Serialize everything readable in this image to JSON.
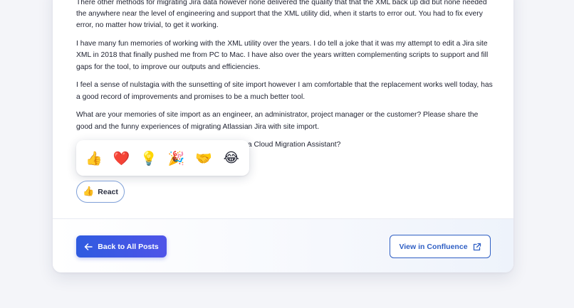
{
  "post": {
    "paragraphs": [
      "There other methods for migrating Jira data however none delivered the quality that that the XML back up did but none needed the anywhere near the level of engineering and support that the XML utility did, when it starts to error out. You had to fix every error, no matter how trivial, to get it working.",
      "I have many fun memories of working with the XML utility over the years. I do tell a joke that it was my attempt to edit a Jira site XML in 2018 that finally pushed me from PC to Mac. I have also over the years written complementing scripts to support and fill gaps for the tool, to improve our outputs and efficiencies.",
      "I feel a sense of nulstagia with the sunsetting of site import however I am comfortable that the replacement works well today, has a good record of improvements and promises to be a much better tool.",
      "What are your memories of site import as an engineer, an administrator, project manager or the customer? Please share the good and the funny experiences of migrating Atlassian Jira with site import."
    ],
    "partial_line": "                                                                   ort - the Jira Cloud Migration Assistant?"
  },
  "reactions": [
    {
      "name": "thumbs-up",
      "glyph": "👍"
    },
    {
      "name": "heart",
      "glyph": "❤️"
    },
    {
      "name": "lightbulb",
      "glyph": "💡"
    },
    {
      "name": "party-popper",
      "glyph": "🎉"
    },
    {
      "name": "handshake",
      "glyph": "🤝"
    },
    {
      "name": "laughing",
      "glyph": "😂"
    }
  ],
  "react_button": {
    "icon": "👍",
    "label": "React"
  },
  "footer": {
    "back_label": "Back to All Posts",
    "view_label": "View in Confluence"
  },
  "colors": {
    "primary": "#2f5be0",
    "primary_end": "#4f54e8",
    "outline": "#2f5fc4",
    "react_border": "#7fa0d8"
  }
}
